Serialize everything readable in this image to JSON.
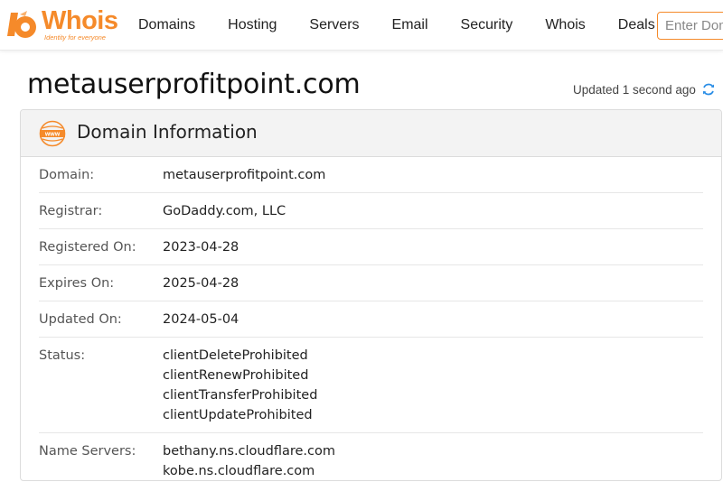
{
  "brand": {
    "name": "Whois",
    "tagline": "Identity for everyone",
    "color": "#f58a2a"
  },
  "nav": {
    "items": [
      "Domains",
      "Hosting",
      "Servers",
      "Email",
      "Security",
      "Whois",
      "Deals"
    ]
  },
  "search": {
    "placeholder": "Enter Domain"
  },
  "page": {
    "title": "metauserprofitpoint.com",
    "updated": "Updated 1 second ago"
  },
  "card": {
    "icon": "www-icon",
    "title": "Domain Information",
    "rows": [
      {
        "label": "Domain:",
        "values": [
          "metauserprofitpoint.com"
        ]
      },
      {
        "label": "Registrar:",
        "values": [
          "GoDaddy.com, LLC"
        ]
      },
      {
        "label": "Registered On:",
        "values": [
          "2023-04-28"
        ]
      },
      {
        "label": "Expires On:",
        "values": [
          "2025-04-28"
        ]
      },
      {
        "label": "Updated On:",
        "values": [
          "2024-05-04"
        ]
      },
      {
        "label": "Status:",
        "values": [
          "clientDeleteProhibited",
          "clientRenewProhibited",
          "clientTransferProhibited",
          "clientUpdateProhibited"
        ]
      },
      {
        "label": "Name Servers:",
        "values": [
          "bethany.ns.cloudflare.com",
          "kobe.ns.cloudflare.com"
        ]
      }
    ]
  }
}
